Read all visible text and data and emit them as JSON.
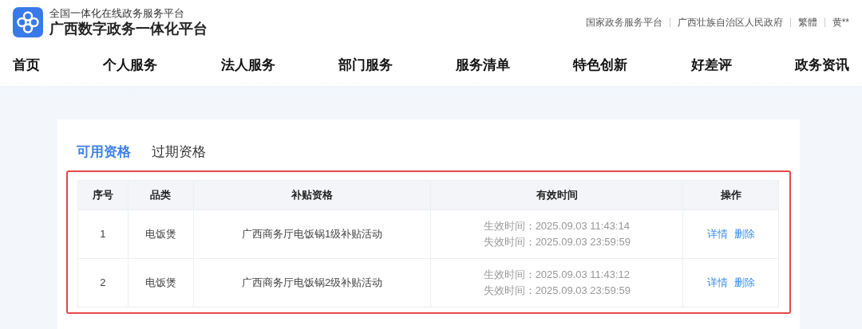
{
  "header": {
    "subtitle": "全国一体化在线政务服务平台",
    "title": "广西数字政务一体化平台",
    "links": [
      "国家政务服务平台",
      "广西壮族自治区人民政府",
      "繁體",
      "黄**"
    ]
  },
  "nav": [
    "首页",
    "个人服务",
    "法人服务",
    "部门服务",
    "服务清单",
    "特色创新",
    "好差评",
    "政务资讯"
  ],
  "tabs": [
    {
      "label": "可用资格",
      "selected": true
    },
    {
      "label": "过期资格",
      "selected": false
    }
  ],
  "table": {
    "columns": [
      "序号",
      "品类",
      "补贴资格",
      "有效时间",
      "操作"
    ],
    "rows": [
      {
        "index": "1",
        "category": "电饭煲",
        "qualification": "广西商务厅电饭锅1级补贴活动",
        "times": [
          "生效时间：2025.09.03 11:43:14",
          "失效时间：2025.09.03 23:59:59"
        ],
        "actions": [
          "详情",
          "删除"
        ]
      },
      {
        "index": "2",
        "category": "电饭煲",
        "qualification": "广西商务厅电饭锅2级补贴活动",
        "times": [
          "生效时间：2025.09.03 11:43:12",
          "失效时间：2025.09.03 23:59:59"
        ],
        "actions": [
          "详情",
          "删除"
        ]
      }
    ]
  }
}
